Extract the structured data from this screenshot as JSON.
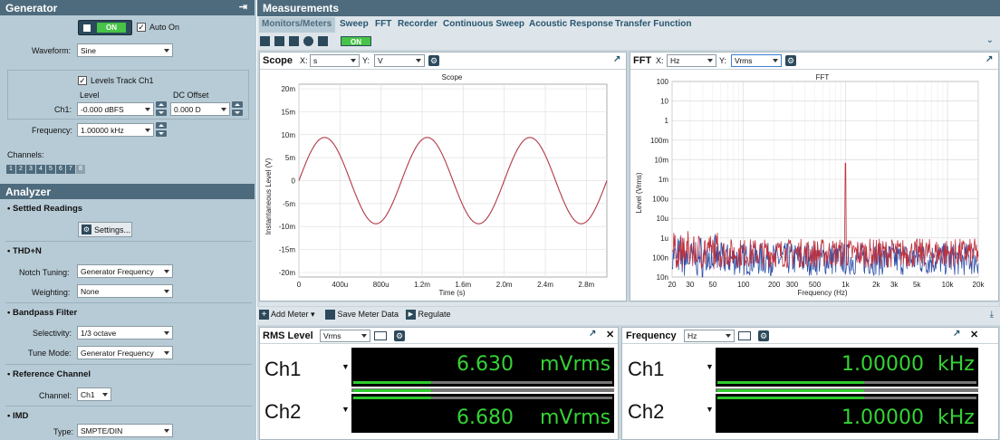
{
  "generator": {
    "title": "Generator",
    "on_label": "ON",
    "auto_on_label": "Auto On",
    "waveform_label": "Waveform:",
    "waveform_value": "Sine",
    "levels_track_label": "Levels Track Ch1",
    "level_label": "Level",
    "dc_offset_label": "DC Offset",
    "ch1_label": "Ch1:",
    "ch1_level": "-0.000 dBFS",
    "dc_offset_value": "0.000 D",
    "frequency_label": "Frequency:",
    "frequency_value": "1.00000 kHz",
    "channels_label": "Channels:",
    "channel_buttons": [
      "1",
      "2",
      "3",
      "4",
      "5",
      "6",
      "7",
      "8"
    ]
  },
  "analyzer": {
    "title": "Analyzer",
    "settled_readings": "Settled Readings",
    "settings_button": "Settings...",
    "thdn": "THD+N",
    "notch_tuning_label": "Notch Tuning:",
    "notch_tuning_value": "Generator Frequency",
    "weighting_label": "Weighting:",
    "weighting_value": "None",
    "bandpass": "Bandpass Filter",
    "selectivity_label": "Selectivity:",
    "selectivity_value": "1/3 octave",
    "tune_mode_label": "Tune Mode:",
    "tune_mode_value": "Generator Frequency",
    "reference_channel": "Reference Channel",
    "channel_label": "Channel:",
    "channel_value": "Ch1",
    "imd": "IMD",
    "type_label": "Type:",
    "type_value": "SMPTE/DIN"
  },
  "measurements": {
    "title": "Measurements",
    "tabs": [
      "Monitors/Meters",
      "Sweep",
      "FFT",
      "Recorder",
      "Continuous Sweep",
      "Acoustic Response",
      "Transfer Function"
    ],
    "toolbar_on": "ON"
  },
  "scope": {
    "title": "Scope",
    "x_label": "X:",
    "x_value": "s",
    "y_label": "Y:",
    "y_value": "V",
    "graph_title": "Scope",
    "ylabel": "Instantaneous Level (V)",
    "xlabel": "Time (s)",
    "y_ticks": [
      "20m",
      "15m",
      "10m",
      "5m",
      "0",
      "-5m",
      "-10m",
      "-15m",
      "-20m"
    ],
    "x_ticks": [
      "0",
      "400u",
      "800u",
      "1.2m",
      "1.6m",
      "2.0m",
      "2.4m",
      "2.8m"
    ]
  },
  "fft": {
    "title": "FFT",
    "x_label": "X:",
    "x_value": "Hz",
    "y_label": "Y:",
    "y_value": "Vrms",
    "graph_title": "FFT",
    "ylabel": "Level (Vrms)",
    "xlabel": "Frequency (Hz)",
    "y_ticks": [
      "100",
      "10",
      "1",
      "100m",
      "10m",
      "1m",
      "100u",
      "10u",
      "1u",
      "100n",
      "10n"
    ],
    "x_ticks": [
      "20",
      "30",
      "50",
      "100",
      "200",
      "300",
      "500",
      "1k",
      "2k",
      "3k",
      "5k",
      "10k",
      "20k"
    ]
  },
  "meter_toolbar": {
    "add_meter": "Add Meter",
    "save_meter_data": "Save Meter Data",
    "regulate": "Regulate"
  },
  "rms_meter": {
    "title": "RMS Level",
    "unit_select": "Vrms",
    "ch1_name": "Ch1",
    "ch1_value": "6.630",
    "ch1_unit": "mVrms",
    "ch2_name": "Ch2",
    "ch2_value": "6.680",
    "ch2_unit": "mVrms"
  },
  "freq_meter": {
    "title": "Frequency",
    "unit_select": "Hz",
    "ch1_name": "Ch1",
    "ch1_value": "1.00000",
    "ch1_unit": "kHz",
    "ch2_name": "Ch2",
    "ch2_value": "1.00000",
    "ch2_unit": "kHz"
  },
  "chart_data": [
    {
      "type": "line",
      "title": "Scope",
      "xlabel": "Time (s)",
      "ylabel": "Instantaneous Level (V)",
      "xlim": [
        0,
        0.003
      ],
      "ylim": [
        -0.021,
        0.021
      ],
      "series": [
        {
          "waveform": "sine",
          "frequency_hz": 1000,
          "amplitude_v": 0.0094,
          "color": "#b03a48"
        }
      ]
    },
    {
      "type": "line",
      "title": "FFT",
      "xlabel": "Frequency (Hz)",
      "ylabel": "Level (Vrms)",
      "xscale": "log",
      "yscale": "log",
      "xlim": [
        20,
        20000
      ],
      "ylim": [
        1e-08,
        100
      ],
      "series": [
        {
          "channel": "Ch1",
          "color": "#c0303c",
          "peak_hz": 1000,
          "peak_vrms": 0.0066,
          "noise_floor_vrms": 2e-07
        },
        {
          "channel": "Ch2",
          "color": "#2d4fa8",
          "noise_floor_vrms": 1e-07
        }
      ]
    }
  ]
}
